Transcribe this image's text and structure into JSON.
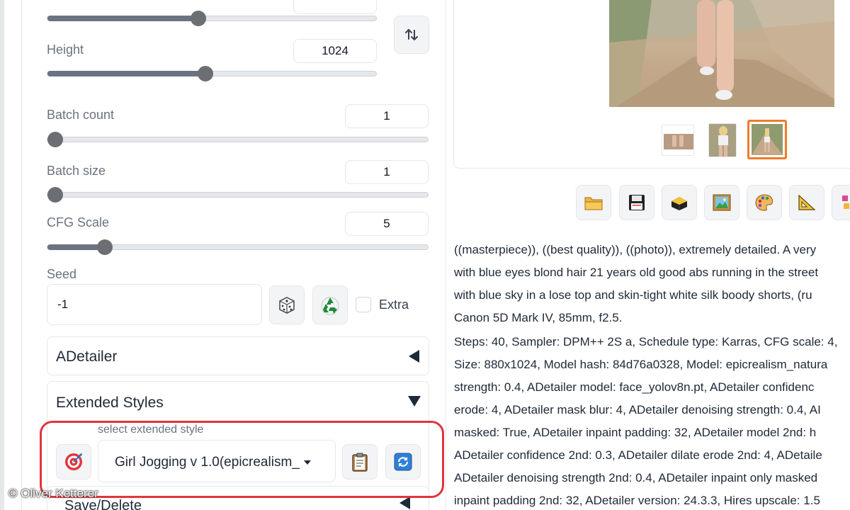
{
  "settings": {
    "width_slider": {
      "value": 0.46
    },
    "height": {
      "label": "Height",
      "value": "1024",
      "slider": 0.48
    },
    "batch_count": {
      "label": "Batch count",
      "value": "1",
      "slider": 0.0
    },
    "batch_size": {
      "label": "Batch size",
      "value": "1",
      "slider": 0.0
    },
    "cfg_scale": {
      "label": "CFG Scale",
      "value": "5",
      "slider": 0.15
    },
    "seed": {
      "label": "Seed",
      "value": "-1",
      "extra_label": "Extra"
    }
  },
  "accordions": {
    "adetailer": "ADetailer",
    "extended_styles": "Extended Styles",
    "save_delete": "Save/Delete"
  },
  "extended_style": {
    "label": "select extended style",
    "selected": "Girl Jogging v 1.0(epicrealism_"
  },
  "toolbar_icons": [
    "folder-icon",
    "save-icon",
    "zip-icon",
    "image-icon",
    "palette-icon",
    "ruler-icon",
    "extras-icon"
  ],
  "generation_info": [
    "((masterpiece)), ((best quality)), ((photo)), extremely detailed. A very",
    "with blue eyes blond hair 21 years old good abs running in the street",
    "with blue sky in a lose top and skin-tight white silk boody shorts, (ru",
    "Canon 5D Mark IV, 85mm, f2.5.",
    "Steps: 40, Sampler: DPM++ 2S a, Schedule type: Karras, CFG scale: 4,",
    "Size: 880x1024, Model hash: 84d76a0328, Model: epicrealism_natura",
    "strength: 0.4, ADetailer model: face_yolov8n.pt, ADetailer confidenc",
    "erode: 4, ADetailer mask blur: 4, ADetailer denoising strength: 0.4, AI",
    "masked: True, ADetailer inpaint padding: 32, ADetailer model 2nd: h",
    "ADetailer confidence 2nd: 0.3, ADetailer dilate erode 2nd: 4, ADetaile",
    "ADetailer denoising strength 2nd: 0.4, ADetailer inpaint only masked",
    "inpaint padding 2nd: 32, ADetailer version: 24.3.3, Hires upscale: 1.5"
  ],
  "watermark": "© Oliver Ketterer",
  "colors": {
    "highlight_red": "#e0353b",
    "thumb_selected": "#f07a2a",
    "accent_blue": "#2563eb"
  }
}
